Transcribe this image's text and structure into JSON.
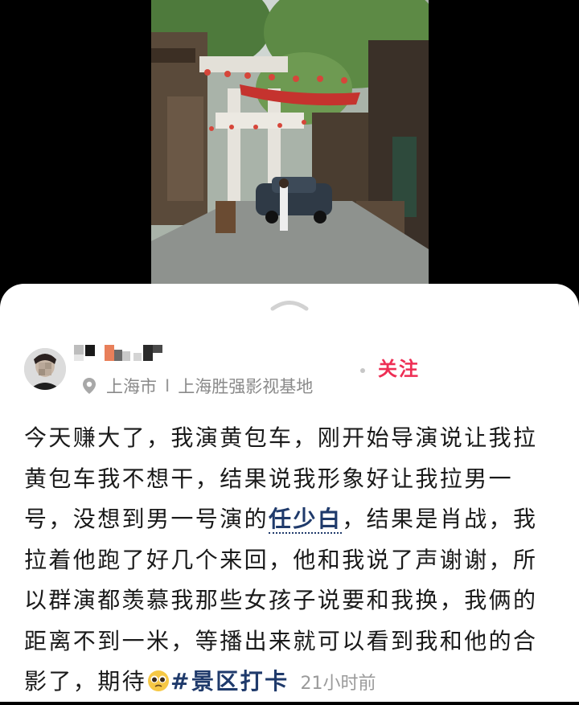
{
  "photo": {
    "alt_subject": "film-set-street-photo"
  },
  "author": {
    "follow_label": "关注",
    "location": {
      "city": "上海市",
      "separator": "I",
      "place": "上海胜强影视基地"
    }
  },
  "post": {
    "text_before_mention": "今天赚大了，我演黄包车，刚开始导演说让我拉黄包车我不想干，结果说我形象好让我拉男一号，没想到男一号演的",
    "mention": "任少白",
    "text_after_mention": "，结果是肖战，我拉着他跑了好几个来回，他和我说了声谢谢，所以群演都羡慕我那些女孩子说要和我换，我俩的距离不到一米，等播出来就可以看到我和他的合影了，期待",
    "emoji": "pleading-face-emoji",
    "hashtag": "#景区打卡",
    "timestamp": "21小时前"
  },
  "colors": {
    "follow": "#ee2e54",
    "link": "#1f3a6b",
    "meta": "#8a8a8a"
  }
}
